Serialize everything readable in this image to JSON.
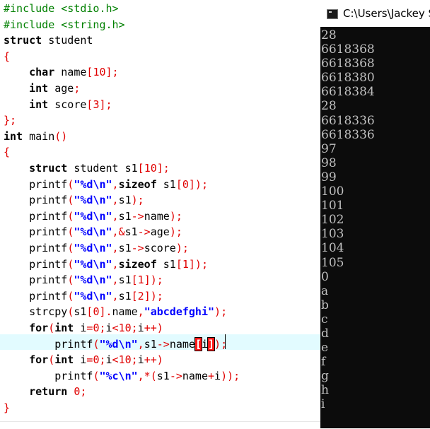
{
  "editor": {
    "current_line_index": 21,
    "lines": [
      [
        [
          "pp",
          "#include <stdio.h>"
        ]
      ],
      [
        [
          "pp",
          "#include <string.h>"
        ]
      ],
      [
        [
          "kw",
          "struct"
        ],
        [
          "id",
          " student"
        ]
      ],
      [
        [
          "br",
          "{"
        ]
      ],
      [
        [
          "id",
          "    "
        ],
        [
          "kw",
          "char"
        ],
        [
          "id",
          " name"
        ],
        [
          "br",
          "["
        ],
        [
          "num",
          "10"
        ],
        [
          "br",
          "]"
        ],
        [
          "op",
          ";"
        ]
      ],
      [
        [
          "id",
          "    "
        ],
        [
          "kw",
          "int"
        ],
        [
          "id",
          " age"
        ],
        [
          "op",
          ";"
        ]
      ],
      [
        [
          "id",
          "    "
        ],
        [
          "kw",
          "int"
        ],
        [
          "id",
          " score"
        ],
        [
          "br",
          "["
        ],
        [
          "num",
          "3"
        ],
        [
          "br",
          "]"
        ],
        [
          "op",
          ";"
        ]
      ],
      [
        [
          "br",
          "}"
        ],
        [
          "op",
          ";"
        ]
      ],
      [
        [
          "kw",
          "int"
        ],
        [
          "id",
          " main"
        ],
        [
          "br",
          "()"
        ]
      ],
      [
        [
          "br",
          "{"
        ]
      ],
      [
        [
          "id",
          "    "
        ],
        [
          "kw",
          "struct"
        ],
        [
          "id",
          " student s1"
        ],
        [
          "br",
          "["
        ],
        [
          "num",
          "10"
        ],
        [
          "br",
          "]"
        ],
        [
          "op",
          ";"
        ]
      ],
      [
        [
          "id",
          "    printf"
        ],
        [
          "br",
          "("
        ],
        [
          "str",
          "\"%d\\n\""
        ],
        [
          "op",
          ","
        ],
        [
          "kw",
          "sizeof"
        ],
        [
          "id",
          " s1"
        ],
        [
          "br",
          "["
        ],
        [
          "num",
          "0"
        ],
        [
          "br",
          "])"
        ],
        [
          "op",
          ";"
        ]
      ],
      [
        [
          "id",
          "    printf"
        ],
        [
          "br",
          "("
        ],
        [
          "str",
          "\"%d\\n\""
        ],
        [
          "op",
          ","
        ],
        [
          "id",
          "s1"
        ],
        [
          "br",
          ")"
        ],
        [
          "op",
          ";"
        ]
      ],
      [
        [
          "id",
          "    printf"
        ],
        [
          "br",
          "("
        ],
        [
          "str",
          "\"%d\\n\""
        ],
        [
          "op",
          ","
        ],
        [
          "id",
          "s1"
        ],
        [
          "op",
          "->"
        ],
        [
          "id",
          "name"
        ],
        [
          "br",
          ")"
        ],
        [
          "op",
          ";"
        ]
      ],
      [
        [
          "id",
          "    printf"
        ],
        [
          "br",
          "("
        ],
        [
          "str",
          "\"%d\\n\""
        ],
        [
          "op",
          ",&"
        ],
        [
          "id",
          "s1"
        ],
        [
          "op",
          "->"
        ],
        [
          "id",
          "age"
        ],
        [
          "br",
          ")"
        ],
        [
          "op",
          ";"
        ]
      ],
      [
        [
          "id",
          "    printf"
        ],
        [
          "br",
          "("
        ],
        [
          "str",
          "\"%d\\n\""
        ],
        [
          "op",
          ","
        ],
        [
          "id",
          "s1"
        ],
        [
          "op",
          "->"
        ],
        [
          "id",
          "score"
        ],
        [
          "br",
          ")"
        ],
        [
          "op",
          ";"
        ]
      ],
      [
        [
          "id",
          "    printf"
        ],
        [
          "br",
          "("
        ],
        [
          "str",
          "\"%d\\n\""
        ],
        [
          "op",
          ","
        ],
        [
          "kw",
          "sizeof"
        ],
        [
          "id",
          " s1"
        ],
        [
          "br",
          "["
        ],
        [
          "num",
          "1"
        ],
        [
          "br",
          "])"
        ],
        [
          "op",
          ";"
        ]
      ],
      [
        [
          "id",
          "    printf"
        ],
        [
          "br",
          "("
        ],
        [
          "str",
          "\"%d\\n\""
        ],
        [
          "op",
          ","
        ],
        [
          "id",
          "s1"
        ],
        [
          "br",
          "["
        ],
        [
          "num",
          "1"
        ],
        [
          "br",
          "])"
        ],
        [
          "op",
          ";"
        ]
      ],
      [
        [
          "id",
          "    printf"
        ],
        [
          "br",
          "("
        ],
        [
          "str",
          "\"%d\\n\""
        ],
        [
          "op",
          ","
        ],
        [
          "id",
          "s1"
        ],
        [
          "br",
          "["
        ],
        [
          "num",
          "2"
        ],
        [
          "br",
          "])"
        ],
        [
          "op",
          ";"
        ]
      ],
      [
        [
          "id",
          "    strcpy"
        ],
        [
          "br",
          "("
        ],
        [
          "id",
          "s1"
        ],
        [
          "br",
          "["
        ],
        [
          "num",
          "0"
        ],
        [
          "br",
          "]"
        ],
        [
          "op",
          "."
        ],
        [
          "id",
          "name"
        ],
        [
          "op",
          ","
        ],
        [
          "str",
          "\"abcdefghi\""
        ],
        [
          "br",
          ")"
        ],
        [
          "op",
          ";"
        ]
      ],
      [
        [
          "id",
          "    "
        ],
        [
          "kw",
          "for"
        ],
        [
          "br",
          "("
        ],
        [
          "kw",
          "int"
        ],
        [
          "id",
          " i"
        ],
        [
          "op",
          "="
        ],
        [
          "num",
          "0"
        ],
        [
          "op",
          ";"
        ],
        [
          "id",
          "i"
        ],
        [
          "op",
          "<"
        ],
        [
          "num",
          "10"
        ],
        [
          "op",
          ";"
        ],
        [
          "id",
          "i"
        ],
        [
          "op",
          "++"
        ],
        [
          "br",
          ")"
        ]
      ],
      [
        [
          "id",
          "        printf"
        ],
        [
          "br",
          "("
        ],
        [
          "str",
          "\"%d\\n\""
        ],
        [
          "op",
          ","
        ],
        [
          "id",
          "s1"
        ],
        [
          "op",
          "->"
        ],
        [
          "id",
          "name"
        ],
        [
          "match",
          "["
        ],
        [
          "id",
          "i"
        ],
        [
          "match",
          "]"
        ],
        [
          "br",
          ")"
        ],
        [
          "op",
          ";"
        ]
      ],
      [
        [
          "id",
          "    "
        ],
        [
          "kw",
          "for"
        ],
        [
          "br",
          "("
        ],
        [
          "kw",
          "int"
        ],
        [
          "id",
          " i"
        ],
        [
          "op",
          "="
        ],
        [
          "num",
          "0"
        ],
        [
          "op",
          ";"
        ],
        [
          "id",
          "i"
        ],
        [
          "op",
          "<"
        ],
        [
          "num",
          "10"
        ],
        [
          "op",
          ";"
        ],
        [
          "id",
          "i"
        ],
        [
          "op",
          "++"
        ],
        [
          "br",
          ")"
        ]
      ],
      [
        [
          "id",
          "        printf"
        ],
        [
          "br",
          "("
        ],
        [
          "str",
          "\"%c\\n\""
        ],
        [
          "op",
          ",*"
        ],
        [
          "br",
          "("
        ],
        [
          "id",
          "s1"
        ],
        [
          "op",
          "->"
        ],
        [
          "id",
          "name"
        ],
        [
          "op",
          "+"
        ],
        [
          "id",
          "i"
        ],
        [
          "br",
          "))"
        ],
        [
          "op",
          ";"
        ]
      ],
      [
        [
          "id",
          "    "
        ],
        [
          "kw",
          "return"
        ],
        [
          "id",
          " "
        ],
        [
          "num",
          "0"
        ],
        [
          "op",
          ";"
        ]
      ],
      [
        [
          "br",
          "}"
        ]
      ]
    ]
  },
  "console": {
    "title": "C:\\Users\\Jackey S",
    "lines": [
      "28",
      "6618368",
      "6618368",
      "6618380",
      "6618384",
      "28",
      "6618336",
      "6618336",
      "97",
      "98",
      "99",
      "100",
      "101",
      "102",
      "103",
      "104",
      "105",
      "0",
      "a",
      "b",
      "c",
      "d",
      "e",
      "f",
      "g",
      "h",
      "i"
    ]
  }
}
